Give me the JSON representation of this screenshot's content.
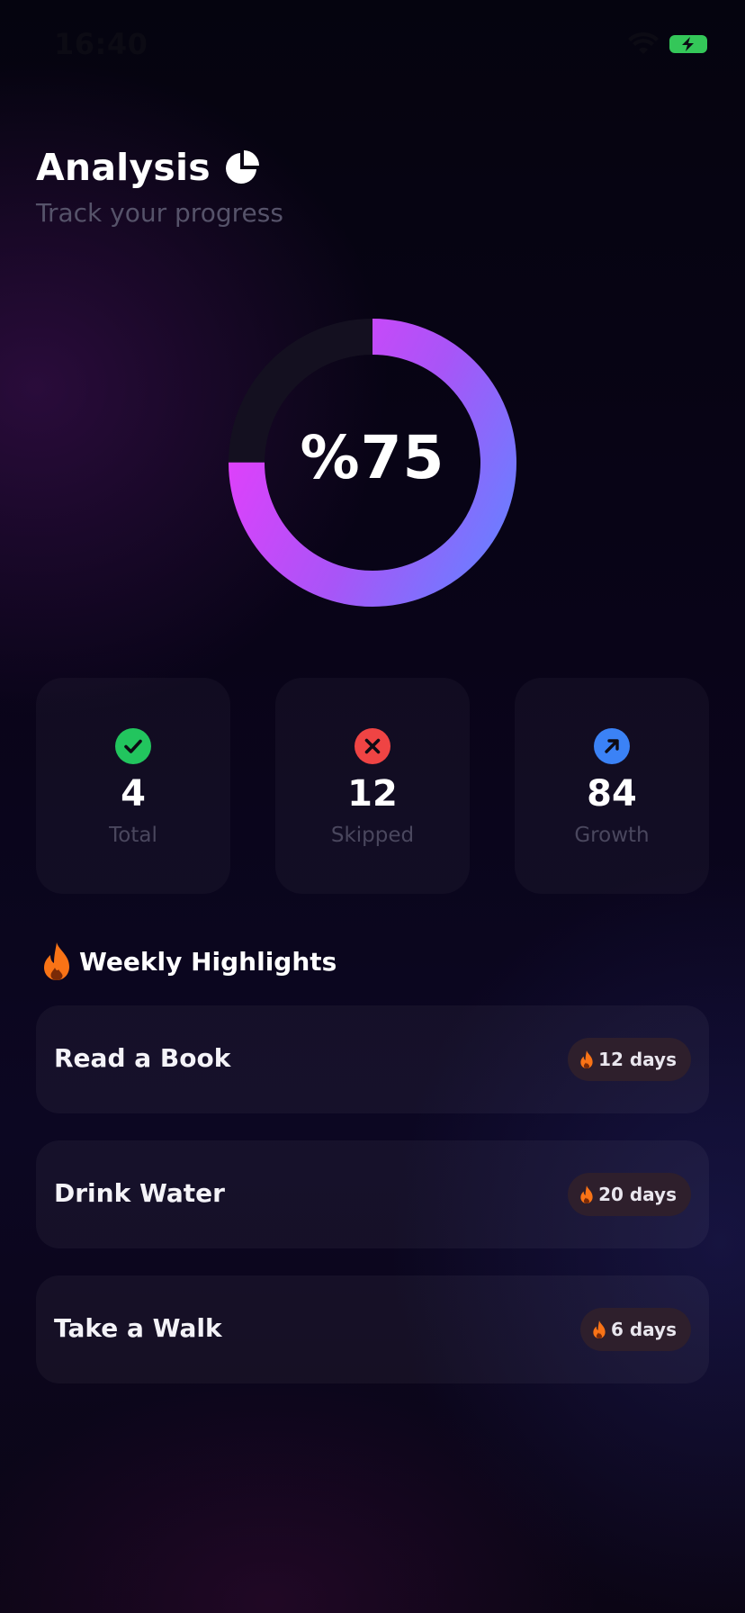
{
  "status_bar": {
    "time": "16:40",
    "icons": [
      "wifi-icon",
      "battery-charging-icon"
    ]
  },
  "header": {
    "title": "Analysis",
    "subtitle": "Track your progress",
    "icon": "pie-chart-icon"
  },
  "progress": {
    "label": "%75",
    "fraction": 0.75,
    "gradient": [
      "#e040fb",
      "#a855f7",
      "#6f7bff"
    ]
  },
  "stats": [
    {
      "value": "4",
      "label": "Total",
      "icon": "check-icon",
      "color": "#22c55e"
    },
    {
      "value": "12",
      "label": "Skipped",
      "icon": "x-icon",
      "color": "#ef4444"
    },
    {
      "value": "84",
      "label": "Growth",
      "icon": "arrow-up-right-icon",
      "color": "#3b82f6"
    }
  ],
  "highlights": {
    "title": "Weekly Highlights",
    "icon": "flame-icon",
    "items": [
      {
        "name": "Read a Book",
        "streak": "12 days"
      },
      {
        "name": "Drink Water",
        "streak": "20 days"
      },
      {
        "name": "Take a Walk",
        "streak": "6 days"
      }
    ]
  },
  "colors": {
    "flame": "#f97316",
    "card_bg": "#16121f",
    "badge_bg": "#2e1f2c"
  }
}
